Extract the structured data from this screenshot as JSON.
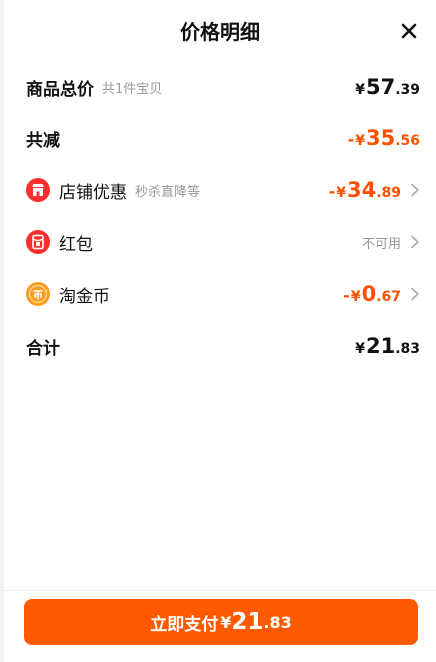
{
  "header": {
    "title": "价格明细"
  },
  "total_goods": {
    "label": "商品总价",
    "sub": "共1件宝贝",
    "symbol": "¥",
    "int": "57",
    "dec": ".39"
  },
  "discount": {
    "label": "共减",
    "minus": "-",
    "symbol": "¥",
    "int": "35",
    "dec": ".56"
  },
  "shop": {
    "label": "店铺优惠",
    "sub": "秒杀直降等",
    "minus": "-",
    "symbol": "¥",
    "int": "34",
    "dec": ".89",
    "icon": "shop-icon"
  },
  "redpacket": {
    "label": "红包",
    "status": "不可用",
    "icon": "red-packet-icon"
  },
  "coins": {
    "label": "淘金币",
    "minus": "-",
    "symbol": "¥",
    "int": "0",
    "dec": ".67",
    "icon": "coin-icon"
  },
  "total": {
    "label": "合计",
    "symbol": "¥",
    "int": "21",
    "dec": ".83"
  },
  "pay": {
    "label": "立即支付",
    "symbol": "¥",
    "int": "21",
    "dec": ".83"
  },
  "colors": {
    "accent": "#ff5000",
    "button": "#ff5a00",
    "icon_red": "#ff2f2f",
    "coin": "#ff9b1f"
  }
}
